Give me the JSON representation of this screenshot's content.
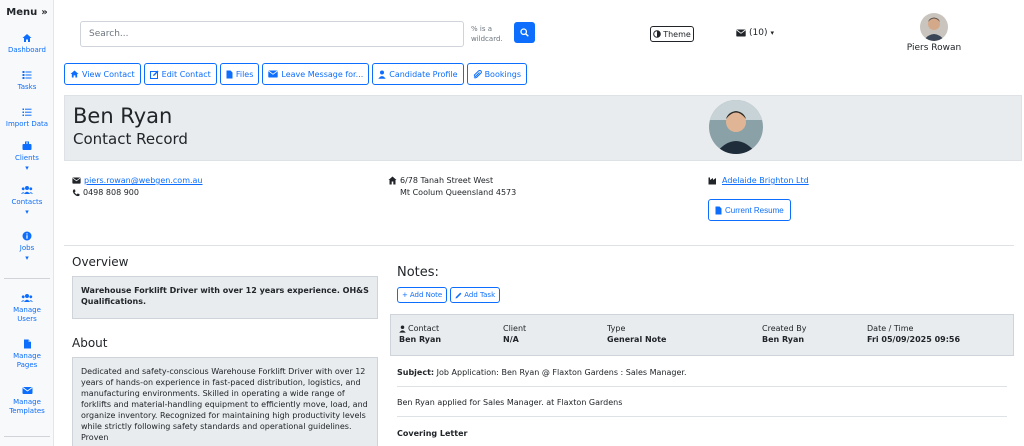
{
  "sidebar": {
    "menu_label": "Menu",
    "menu_toggle": "»",
    "items": [
      {
        "label": "Dashboard",
        "icon": "home-icon"
      },
      {
        "label": "Tasks",
        "icon": "tasks-icon"
      },
      {
        "label": "Import Data",
        "icon": "list-icon"
      },
      {
        "label": "Clients",
        "icon": "briefcase-icon"
      },
      {
        "label": "Contacts",
        "icon": "users-icon"
      },
      {
        "label": "Jobs",
        "icon": "info-circle-icon"
      },
      {
        "label": "Manage Users",
        "icon": "users-icon"
      },
      {
        "label": "Manage Pages",
        "icon": "file-icon"
      },
      {
        "label": "Manage Templates",
        "icon": "envelope-icon"
      }
    ]
  },
  "topbar": {
    "search_placeholder": "Search...",
    "wildcard_hint": "% is a wildcard.",
    "theme_label": "Theme",
    "messages_label": "(10)",
    "user_name": "Piers Rowan"
  },
  "toolbar": {
    "view_contact": "View Contact",
    "edit_contact": "Edit Contact",
    "files": "Files",
    "leave_message": "Leave Message for...",
    "candidate_profile": "Candidate Profile",
    "bookings": "Bookings"
  },
  "header": {
    "name": "Ben Ryan",
    "subtitle": "Contact Record"
  },
  "contact": {
    "email": "piers.rowan@webgen.com.au",
    "phone": "0498 808 900",
    "address_line1": "6/78 Tanah Street West",
    "address_line2": "Mt Coolum  Queensland  4573",
    "company": "Adelaide Brighton Ltd",
    "resume_label": "Current Resume"
  },
  "overview": {
    "title": "Overview",
    "text": "Warehouse Forklift Driver with over 12 years experience. OH&S Qualifications."
  },
  "about": {
    "title": "About",
    "text": "Dedicated and safety-conscious Warehouse Forklift Driver with over 12 years of hands-on experience in fast-paced distribution, logistics, and manufacturing environments. Skilled in operating a wide range of forklifts and material-handling equipment to efficiently move, load, and organize inventory. Recognized for maintaining high productivity levels while strictly following safety standards and operational guidelines. Proven"
  },
  "notes": {
    "title": "Notes:",
    "add_note": "Add Note",
    "add_task": "Add Task",
    "columns": [
      {
        "label": "Contact",
        "value": "Ben Ryan"
      },
      {
        "label": "Client",
        "value": "N/A"
      },
      {
        "label": "Type",
        "value": "General Note"
      },
      {
        "label": "Created By",
        "value": "Ben Ryan"
      },
      {
        "label": "Date / Time",
        "value": "Fri 05/09/2025 09:56"
      }
    ],
    "subject_label": "Subject:",
    "subject_text": "Job Application: Ben Ryan @ Flaxton Gardens : Sales Manager.",
    "body": "Ben Ryan applied for Sales Manager. at Flaxton Gardens",
    "covering_letter": "Covering Letter"
  },
  "colors": {
    "accent": "#0d6efd",
    "panel": "#e9ecef"
  }
}
